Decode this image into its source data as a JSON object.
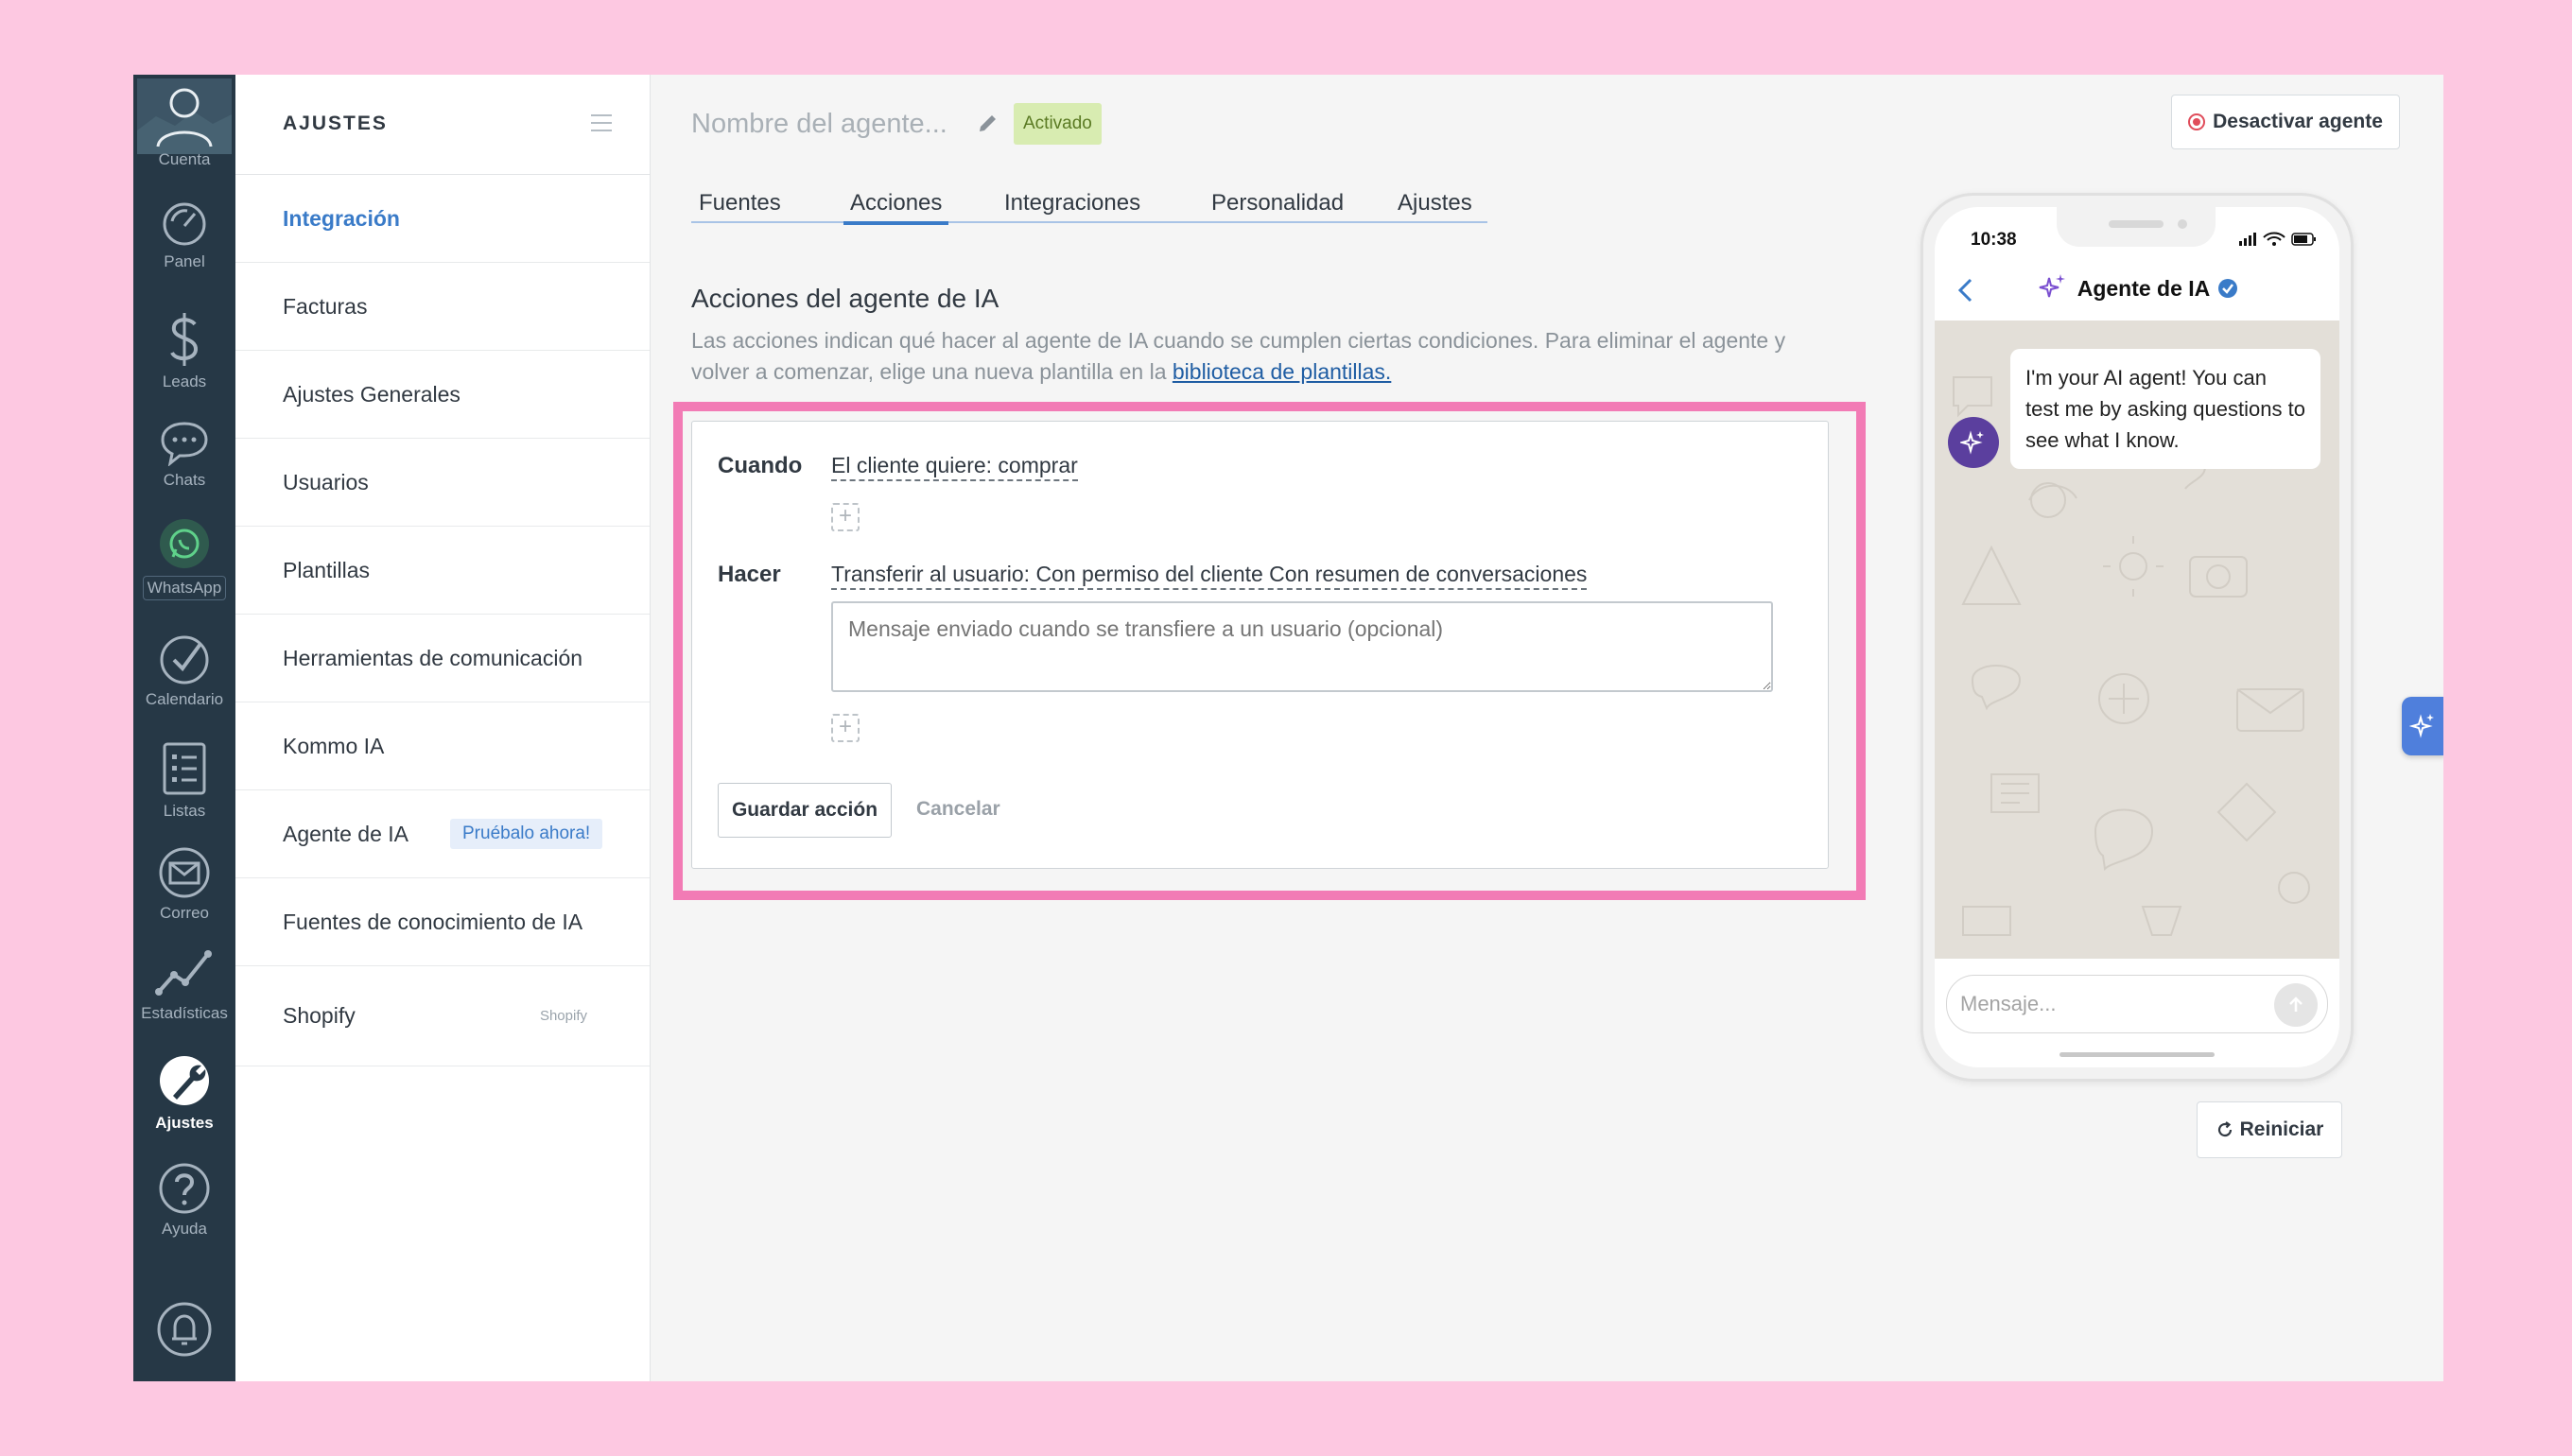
{
  "nav": {
    "items": [
      {
        "label": "Cuenta",
        "icon": "user-icon"
      },
      {
        "label": "Panel",
        "icon": "dashboard-icon"
      },
      {
        "label": "Leads",
        "icon": "dollar-icon"
      },
      {
        "label": "Chats",
        "icon": "chat-icon"
      },
      {
        "label": "WhatsApp",
        "icon": "whatsapp-icon"
      },
      {
        "label": "Calendario",
        "icon": "check-icon"
      },
      {
        "label": "Listas",
        "icon": "list-icon"
      },
      {
        "label": "Correo",
        "icon": "mail-icon"
      },
      {
        "label": "Estadísticas",
        "icon": "stats-icon"
      },
      {
        "label": "Ajustes",
        "icon": "wrench-icon"
      },
      {
        "label": "Ayuda",
        "icon": "help-icon"
      }
    ],
    "active": "Ajustes"
  },
  "settings": {
    "title": "AJUSTES",
    "items": [
      {
        "label": "Integración"
      },
      {
        "label": "Facturas"
      },
      {
        "label": "Ajustes Generales"
      },
      {
        "label": "Usuarios"
      },
      {
        "label": "Plantillas"
      },
      {
        "label": "Herramientas de comunicación"
      },
      {
        "label": "Kommo IA"
      },
      {
        "label": "Agente de IA",
        "badge": "Pruébalo ahora!"
      },
      {
        "label": "Fuentes de conocimiento de IA"
      },
      {
        "label": "Shopify",
        "small": "Shopify"
      }
    ]
  },
  "header": {
    "agent_name_placeholder": "Nombre del agente...",
    "status": "Activado",
    "deactivate_label": "Desactivar agente"
  },
  "tabs": [
    {
      "label": "Fuentes"
    },
    {
      "label": "Acciones"
    },
    {
      "label": "Integraciones"
    },
    {
      "label": "Personalidad"
    },
    {
      "label": "Ajustes"
    }
  ],
  "active_tab": "Acciones",
  "section": {
    "title": "Acciones del agente de IA",
    "desc_text": "Las acciones indican qué hacer al agente de IA cuando se cumplen ciertas condiciones. Para eliminar el agente y volver a comenzar, elige una nueva plantilla en la ",
    "desc_link": "biblioteca de plantillas."
  },
  "action": {
    "when_label": "Cuando",
    "when_value": "El cliente quiere: comprar",
    "do_label": "Hacer",
    "do_value": "Transferir al usuario: Con permiso del cliente Con resumen de conversaciones",
    "message_placeholder": "Mensaje enviado cuando se transfiere a un usuario (opcional)",
    "save_label": "Guardar acción",
    "cancel_label": "Cancelar"
  },
  "phone": {
    "time": "10:38",
    "title": "Agente de IA",
    "bubble_text": "I'm your AI agent! You can test me by asking questions to see what I know.",
    "input_placeholder": "Mensaje...",
    "restart_label": "Reiniciar"
  },
  "colors": {
    "accent": "#3a7bc8",
    "highlight": "#f27bb5",
    "nav_bg": "#263846",
    "status_bg": "#d8ecb1"
  }
}
